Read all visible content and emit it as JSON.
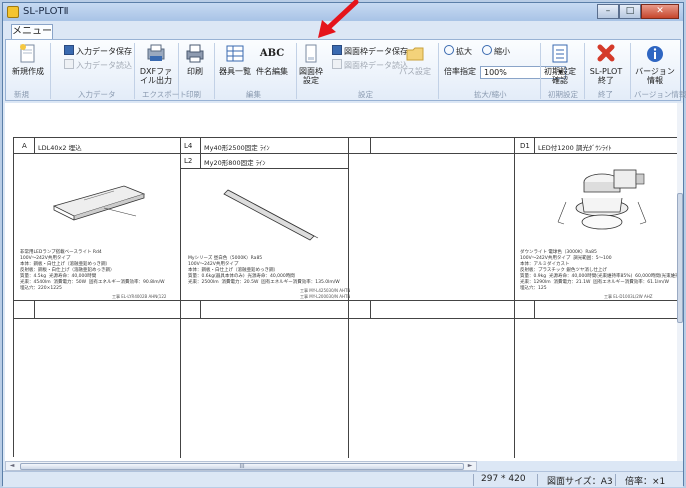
{
  "window": {
    "title": "SL-PLOTⅡ",
    "minimize": "–",
    "maximize": "□",
    "close": "✕"
  },
  "menu_tab": "メニュー",
  "ribbon": {
    "new": "新規作成",
    "save_input": "入力データ保存",
    "read_input": "入力データ読込",
    "dxf_output": "DXFファイル出力",
    "print": "印刷",
    "equipment_list": "器具一覧",
    "item_edit": "件名編集",
    "abc": "ABC",
    "frame_setting": "図面枠設定",
    "save_frame": "図面枠データ保存",
    "read_frame": "図面枠データ読込",
    "path_setting": "パス設定",
    "zoom_in": "拡大",
    "zoom_out": "縮小",
    "ratio_label": "倍率指定",
    "ratio_value": "100%",
    "init_setting": "初期設定確認",
    "exit": "SL-PLOT終了",
    "version": "バージョン情報",
    "groups": {
      "new": "新規",
      "input": "入力データ",
      "export": "エクスポート",
      "print": "印刷",
      "edit": "編集",
      "setting": "設定",
      "zoom": "拡大/縮小",
      "init": "初期設定",
      "exit": "終了",
      "version": "バージョン情報"
    }
  },
  "sheet": {
    "cells": [
      {
        "code": "A",
        "name": "LDL40x2 埋込",
        "desc": "非常用LEDランプ搭載ベースライト Rd4\n100V～242V共用タイプ\n本体：鋼板・白仕上げ（溶融亜鉛めっき鋼）\n反射板：鋼板・白仕上げ（溶融亜鉛めっき鋼）\n質量：4.5kg  光源寿命：40,000時間\n光束：4540lm  消費電力：50W  固有エネルギー消費効率：90.8lm/W\n埋込穴：220×1225",
        "ref": "工事 EL-LYR4002B AHN(122"
      },
      {
        "code": "L4",
        "name": "My40形2500固定 ﾗｲﾝ",
        "sub_code": "L2",
        "sub_name": "My20形800固定 ﾗｲﾝ",
        "desc": "Myシリーズ 昼白色（5000K）Ra85\n100V～242V共用タイプ\n本体：鋼板・白仕上げ（溶融亜鉛めっき鋼）\n質量：0.6kg(器具本体のみ)  光源寿命：40,000時間\n光束：2500lm  消費電力：20.5W  固有エネルギー消費効率：135.0lm/W",
        "ref": "工事 MY-L425030/N AHTN\n工事 MY-L200030/N AHTN"
      },
      {
        "code": "",
        "name": "",
        "desc": "",
        "ref": ""
      },
      {
        "code": "D1",
        "name": "LED付1200 調光ﾀﾞｳﾝﾗｲﾄ",
        "desc": "ダウンライト 電球色（3000K）Ra85\n100V～242V共用タイプ  調光範囲：5～100\n本体：アルミダイカスト\n反射板：プラスチック 銀色ツヤ消し仕上げ\n質量：0.9kg  光源寿命：40,000時間(光束維持率85%)  60,000時間(光束維持率70%)\n光束：1290lm  消費電力：21.1W  固有エネルギー消費効率：61.1lm/W\n埋込穴：125",
        "ref": "工事 EL-D1003L/2W AHZ"
      }
    ]
  },
  "scroll": {
    "thumb_label": "III"
  },
  "status": {
    "size": "297 * 420",
    "paper": "図面サイズ：A3",
    "zoom": "倍率：×1"
  }
}
